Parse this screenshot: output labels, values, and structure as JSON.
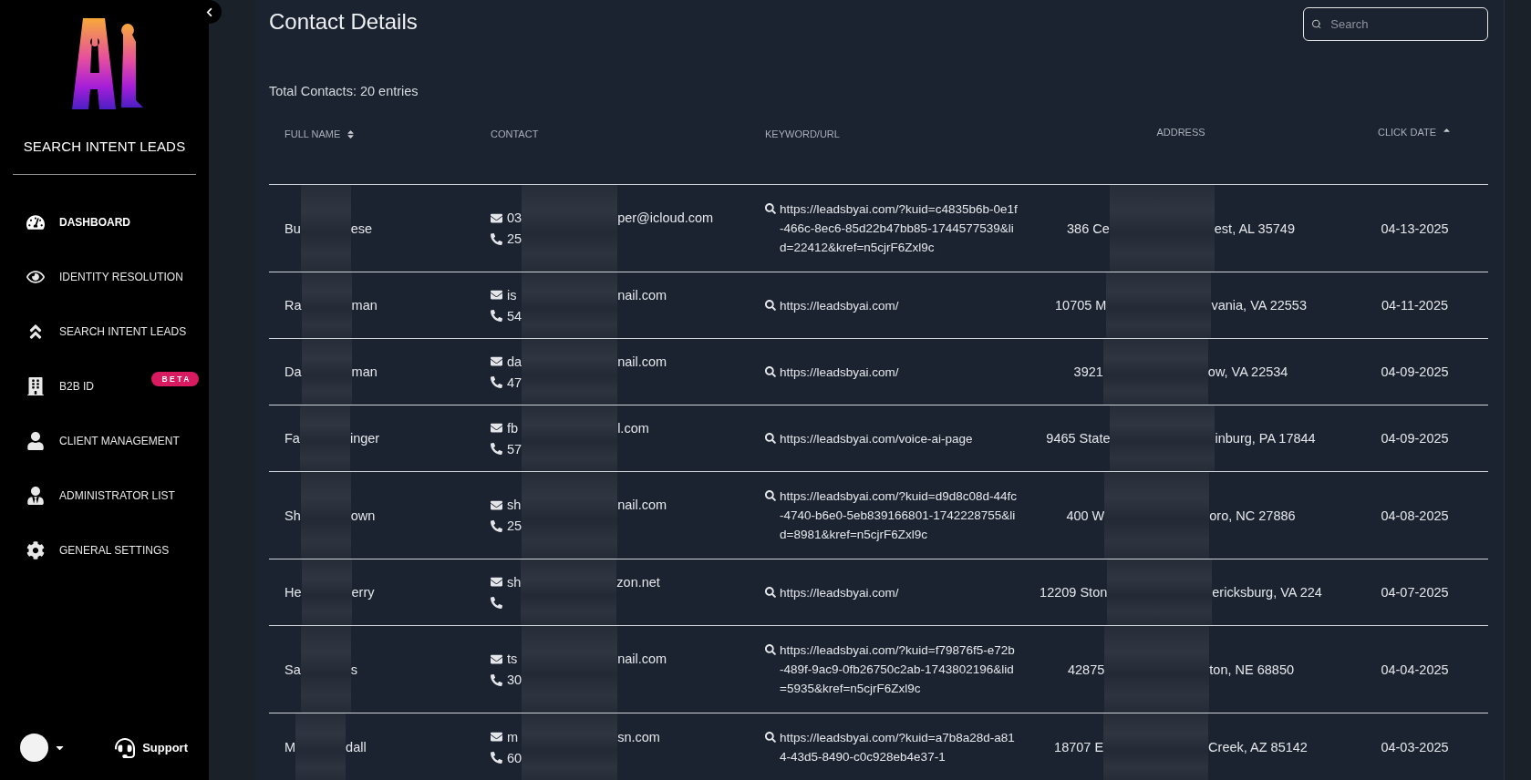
{
  "sidebar": {
    "brand": "SEARCH INTENT LEADS",
    "items": [
      {
        "kind": "dashboard",
        "label": "DASHBOARD",
        "selected": true
      },
      {
        "kind": "eye",
        "label": "IDENTITY RESOLUTION",
        "selected": false
      },
      {
        "kind": "chevrons",
        "label": "SEARCH INTENT LEADS",
        "selected": false
      },
      {
        "kind": "building",
        "label": "B2B ID",
        "selected": false,
        "badge": "BETA"
      },
      {
        "kind": "user",
        "label": "CLIENT MANAGEMENT",
        "selected": false
      },
      {
        "kind": "admin",
        "label": "ADMINISTRATOR LIST",
        "selected": false
      },
      {
        "kind": "gear",
        "label": "GENERAL SETTINGS",
        "selected": false
      }
    ],
    "support": "Support"
  },
  "page": {
    "title": "Contact Details",
    "search": {
      "placeholder": "Search"
    },
    "total": "Total Contacts: 20 entries"
  },
  "table": {
    "columns": [
      {
        "label": "FULL NAME",
        "sortable": true,
        "sorted": false
      },
      {
        "label": "CONTACT"
      },
      {
        "label": "KEYWORD/URL"
      },
      {
        "label": "ADDRESS"
      },
      {
        "label": "CLICK DATE",
        "sortable": true,
        "sorted": true
      }
    ],
    "rows": [
      {
        "name_start": "Bu",
        "name_end": "ese",
        "email_start": "03",
        "email_end": "per@icloud.com",
        "phone_start": "25",
        "url": "https://leadsbyai.com/?kuid=c4835b6b-0e1f-466c-8ec6-85d22b47bb85-1744577539&lid=22412&kref=n5cjrF6Zxl9c",
        "address_start": "386 Ce",
        "address_end": "est, AL 35749",
        "date": "04-13-2025"
      },
      {
        "name_start": "Ra",
        "name_end": "man",
        "email_start": "is",
        "email_end": "nail.com",
        "phone_start": "54",
        "url": "https://leadsbyai.com/",
        "address_start": "10705 M",
        "address_end": "vania, VA 22553",
        "date": "04-11-2025"
      },
      {
        "name_start": "Da",
        "name_end": "man",
        "email_start": "da",
        "email_end": "nail.com",
        "phone_start": "47",
        "url": "https://leadsbyai.com/",
        "address_start": "3921",
        "address_end": "ow, VA 22534",
        "date": "04-09-2025"
      },
      {
        "name_start": "Fa",
        "name_end": "inger",
        "email_start": "fb",
        "email_end": "l.com",
        "phone_start": "57",
        "url": "https://leadsbyai.com/voice-ai-page",
        "address_start": "9465 State",
        "address_end": "inburg, PA 17844",
        "date": "04-09-2025"
      },
      {
        "name_start": "Sh",
        "name_end": "own",
        "email_start": "sh",
        "email_end": "nail.com",
        "phone_start": "25",
        "url": "https://leadsbyai.com/?kuid=d9d8c08d-44fc-4740-b6e0-5eb839166801-1742228755&lid=8981&kref=n5cjrF6Zxl9c",
        "address_start": "400 W",
        "address_end": "oro, NC 27886",
        "date": "04-08-2025"
      },
      {
        "name_start": "He",
        "name_end": "erry",
        "email_start": "sh",
        "email_end": "zon.net",
        "url": "https://leadsbyai.com/",
        "address_start": "12209 Ston",
        "address_end": "ericksburg, VA 224",
        "date": "04-07-2025"
      },
      {
        "name_start": "Sa",
        "name_end": "s",
        "email_start": "ts",
        "email_end": "nail.com",
        "phone_start": "30",
        "url": "https://leadsbyai.com/?kuid=f79876f5-e72b-489f-9ac9-0fb26750c2ab-1743802196&lid=5935&kref=n5cjrF6Zxl9c",
        "address_start": "42875",
        "address_end": "ton, NE 68850",
        "date": "04-04-2025"
      },
      {
        "name_start": "M",
        "name_end": "dall",
        "email_start": "m",
        "email_end": "sn.com",
        "phone_start": "60",
        "url": "https://leadsbyai.com/?kuid=a7b8a28d-a814-43d5-8490-c0c928eb4e37-1",
        "address_start": "18707 E",
        "address_end": "Creek, AZ 85142",
        "date": "04-03-2025"
      }
    ]
  }
}
